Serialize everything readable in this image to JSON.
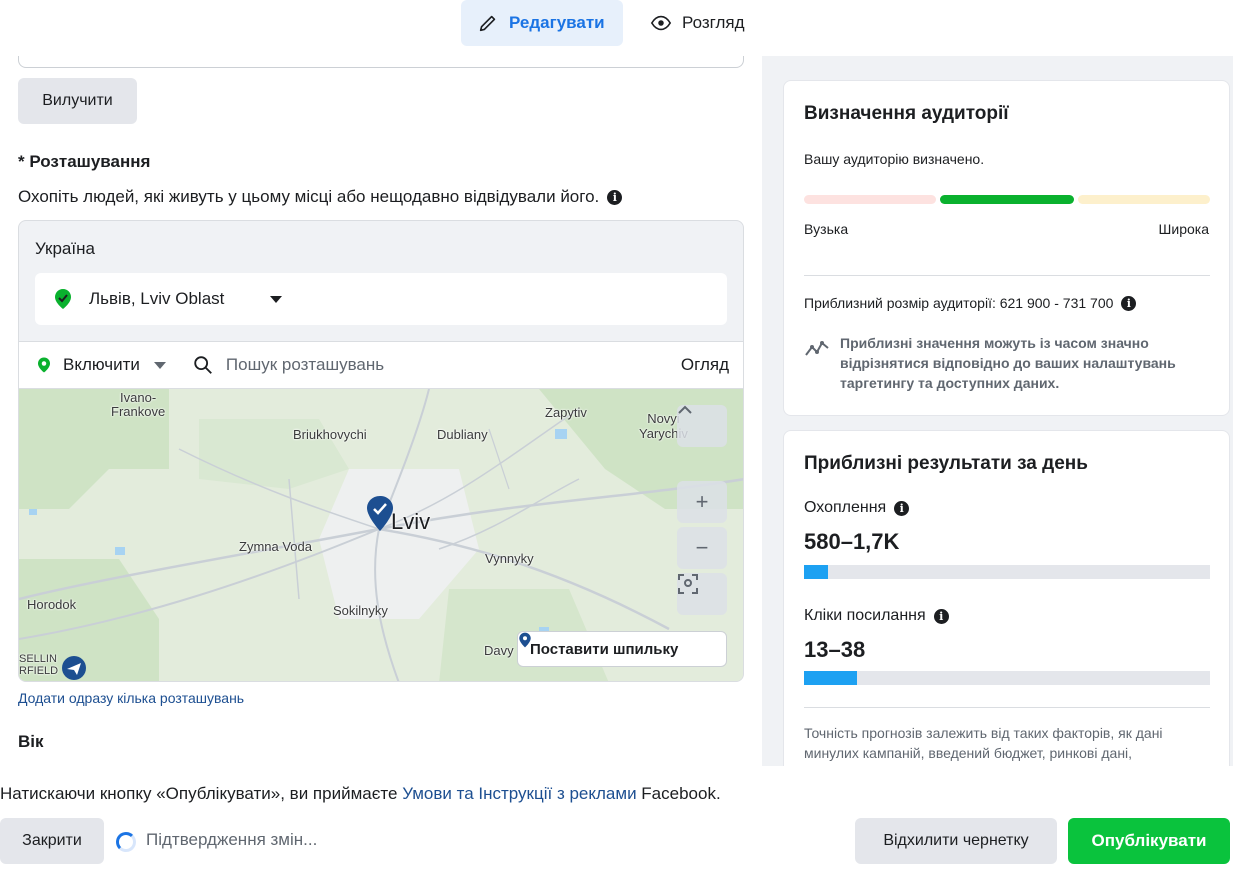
{
  "tabs": {
    "edit": "Редагувати",
    "preview": "Розгляд"
  },
  "left": {
    "exclude_btn": "Вилучити",
    "location_title": "* Розташування",
    "location_desc": "Охопіть людей, які живуть у цьому місці або нещодавно відвідували його.",
    "country": "Україна",
    "selected_city": "Львів, Lviv Oblast",
    "include_label": "Включити",
    "search_placeholder": "Пошук розташувань",
    "review_link": "Огляд",
    "map_labels": {
      "ivano_frankove": "Ivano-\nFrankove",
      "briukhovychi": "Briukhovychi",
      "dubliany": "Dubliany",
      "zapytiv": "Zapytiv",
      "novyi_yarychiv": "Novyi\nYarychiv",
      "lviv": "Lviv",
      "zymna_voda": "Zymna Voda",
      "vynnyky": "Vynnyky",
      "horodok": "Horodok",
      "sokilnyky": "Sokilnyky",
      "davy": "Davy",
      "corner": "SELLIN\nRFIELD"
    },
    "map_zoom_in": "+",
    "map_zoom_out": "−",
    "drop_pin": "Поставити шпильку",
    "add_bulk": "Додати одразу кілька розташувань",
    "age_label": "Вік"
  },
  "audience": {
    "title": "Визначення аудиторії",
    "status": "Вашу аудиторію визначено.",
    "narrow": "Вузька",
    "broad": "Широка",
    "size_label": "Приблизний розмір аудиторії: 621 900 - 731 700",
    "note": "Приблизні значення можуть із часом значно відрізнятися відповідно до ваших налаштувань таргетингу та доступних даних.",
    "colors": {
      "narrow": "#fde2e0",
      "defined": "#0ab12e",
      "broad": "#fdf0cc"
    }
  },
  "daily": {
    "title": "Приблизні результати за день",
    "reach_label": "Охоплення",
    "reach_value": "580–1,7K",
    "reach_fill": 0.06,
    "clicks_label": "Кліки посилання",
    "clicks_value": "13–38",
    "clicks_fill": 0.13,
    "footnote": "Точність прогнозів залежить від таких факторів, як дані минулих кампаній, введений бюджет, ринкові дані,"
  },
  "bottom": {
    "terms_prefix": "Натискаючи кнопку «Опублікувати», ви приймаєте",
    "terms_link": "Умови та Інструкції з реклами",
    "terms_suffix": "Facebook.",
    "close_btn": "Закрити",
    "confirming": "Підтвердження змін...",
    "reject_btn": "Відхилити чернетку",
    "publish_btn": "Опублікувати"
  }
}
